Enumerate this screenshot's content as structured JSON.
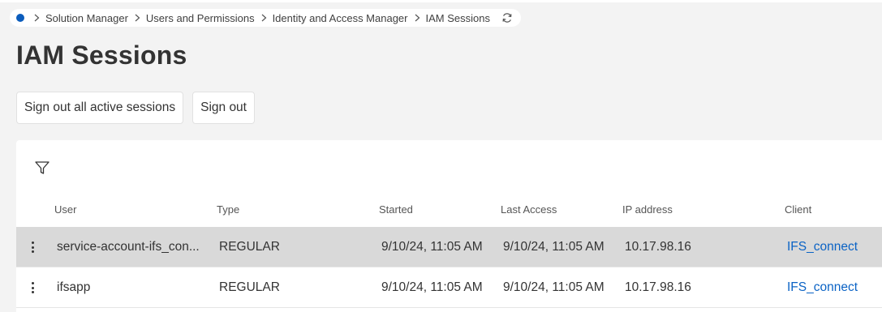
{
  "breadcrumb": {
    "items": [
      "Solution Manager",
      "Users and Permissions",
      "Identity and Access Manager",
      "IAM Sessions"
    ]
  },
  "page": {
    "title": "IAM Sessions"
  },
  "actions": {
    "sign_out_all_label": "Sign out all active sessions",
    "sign_out_label": "Sign out"
  },
  "table": {
    "columns": [
      "User",
      "Type",
      "Started",
      "Last Access",
      "IP address",
      "Client"
    ],
    "rows": [
      {
        "user": "service-account-ifs_con...",
        "type": "REGULAR",
        "started": "9/10/24, 11:05 AM",
        "last_access": "9/10/24, 11:05 AM",
        "ip": "10.17.98.16",
        "client": "IFS_connect",
        "selected": true
      },
      {
        "user": "ifsapp",
        "type": "REGULAR",
        "started": "9/10/24, 11:05 AM",
        "last_access": "9/10/24, 11:05 AM",
        "ip": "10.17.98.16",
        "client": "IFS_connect",
        "selected": false
      }
    ]
  },
  "icons": {
    "home": "home-dot-icon",
    "separator": "chevron-right-icon",
    "refresh": "refresh-icon",
    "filter": "filter-icon",
    "row_menu": "kebab-menu-icon"
  },
  "colors": {
    "accent": "#0b5cbc",
    "link": "#0b63c5",
    "selected_row": "#d9d9d9",
    "background": "#f3f3f3"
  }
}
